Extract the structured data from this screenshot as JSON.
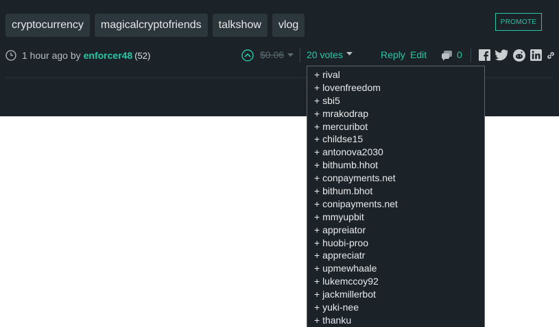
{
  "tags": [
    "cryptocurrency",
    "magicalcryptofriends",
    "talkshow",
    "vlog"
  ],
  "promote_label": "PROMOTE",
  "meta": {
    "time": "1 hour ago by",
    "author": "enforcer48",
    "reputation": "(52)"
  },
  "payout": "$0.06",
  "votes_label": "20 votes",
  "reply_label": "Reply",
  "edit_label": "Edit",
  "comments_count": "0",
  "share_icons": [
    "facebook-icon",
    "twitter-icon",
    "reddit-icon",
    "linkedin-icon",
    "link-icon"
  ],
  "voters": [
    "+ rival",
    "+ lovenfreedom",
    "+ sbi5",
    "+ mrakodrap",
    "+ mercuribot",
    "+ childse15",
    "+ antonova2030",
    "+ bithumb.hhot",
    "+ conpayments.net",
    "+ bithum.bhot",
    "+ conipayments.net",
    "+ mmyupbit",
    "+ appreiator",
    "+ huobi-proo",
    "+ appreciatr",
    "+ upmewhaale",
    "+ lukemccoy92",
    "+ jackmillerbot",
    "+ yuki-nee",
    "+ thanku"
  ],
  "colors": {
    "accent": "#27c6a6",
    "background_dark": "#1c2328",
    "tag_bg": "#2c363d"
  }
}
